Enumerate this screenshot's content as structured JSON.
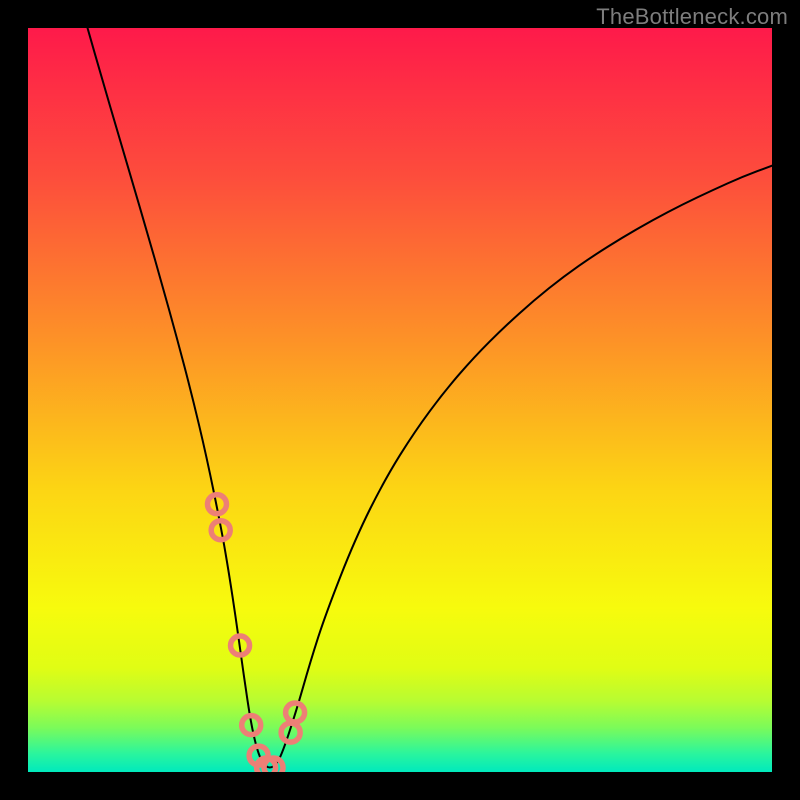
{
  "watermark": "TheBottleneck.com",
  "colors": {
    "frame": "#000000",
    "curve": "#000000",
    "markers": "#ed7f76",
    "gradient_stops": [
      {
        "offset": 0.0,
        "color": "#fe1a4a"
      },
      {
        "offset": 0.2,
        "color": "#fd4d3c"
      },
      {
        "offset": 0.42,
        "color": "#fd9227"
      },
      {
        "offset": 0.62,
        "color": "#fcd514"
      },
      {
        "offset": 0.78,
        "color": "#f7fb0d"
      },
      {
        "offset": 0.86,
        "color": "#e0fd14"
      },
      {
        "offset": 0.905,
        "color": "#b7fc32"
      },
      {
        "offset": 0.94,
        "color": "#7cfb59"
      },
      {
        "offset": 0.975,
        "color": "#2bf59d"
      },
      {
        "offset": 1.0,
        "color": "#00eabd"
      }
    ]
  },
  "layout": {
    "outer_w": 800,
    "outer_h": 800,
    "inner_x": 28,
    "inner_y": 28,
    "inner_w": 744,
    "inner_h": 744,
    "curve_stroke": 2.0,
    "marker_r": 9.5,
    "marker_stroke": 5.5
  },
  "chart_data": {
    "type": "line",
    "title": "",
    "xlabel": "",
    "ylabel": "",
    "xlim": [
      0,
      100
    ],
    "ylim": [
      0,
      100
    ],
    "grid": false,
    "legend": false,
    "series": [
      {
        "name": "bottleneck-curve",
        "x": [
          8,
          10,
          12,
          14,
          16,
          18,
          20,
          22,
          24,
          26,
          27,
          28,
          29,
          30,
          31,
          32,
          33,
          34,
          36,
          38,
          40,
          44,
          48,
          52,
          56,
          60,
          64,
          68,
          72,
          76,
          80,
          84,
          88,
          92,
          96,
          100
        ],
        "y": [
          100,
          93.0,
          86.2,
          79.4,
          72.6,
          65.6,
          58.4,
          50.8,
          42.4,
          32.6,
          26.8,
          20.2,
          13.0,
          6.3,
          2.2,
          0.6,
          0.6,
          2.0,
          8.0,
          15.0,
          21.2,
          31.4,
          39.4,
          45.8,
          51.2,
          55.8,
          59.8,
          63.4,
          66.6,
          69.4,
          71.9,
          74.2,
          76.3,
          78.2,
          80.0,
          81.5
        ]
      }
    ],
    "markers": {
      "name": "highlight-points",
      "x": [
        25.4,
        25.9,
        28.5,
        30.0,
        31.0,
        32.0,
        33.0,
        35.3,
        35.9
      ],
      "y": [
        36.0,
        32.5,
        17.0,
        6.3,
        2.2,
        0.6,
        0.6,
        5.3,
        8.0
      ]
    }
  }
}
